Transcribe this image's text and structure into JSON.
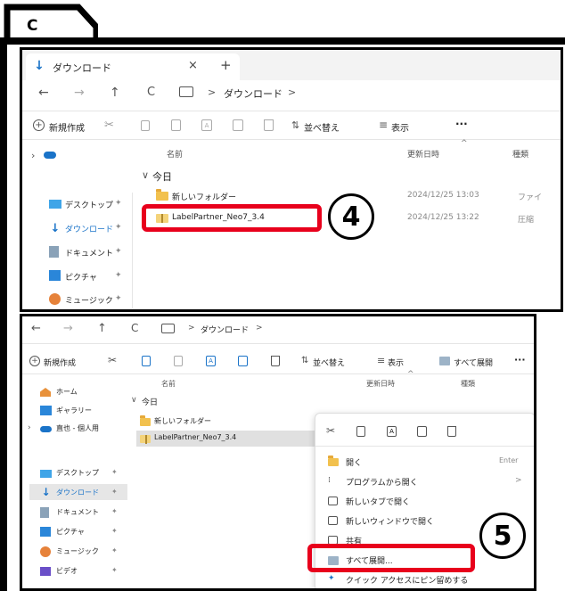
{
  "tag": {
    "letter": "C"
  },
  "panel1": {
    "tab_title": "ダウンロード",
    "tab_close": "×",
    "tab_new": "+",
    "nav_back": "←",
    "nav_forward": "→",
    "nav_up": "↑",
    "nav_refresh": "C",
    "address": "ダウンロード",
    "address_chevron": ">",
    "toolbar": {
      "new": "新規作成",
      "sort": "並べ替え",
      "view": "表示",
      "more": "···"
    },
    "columns": {
      "name": "名前",
      "date": "更新日時",
      "type": "種類"
    },
    "group": "今日",
    "sidebar": [
      {
        "label": "デスクトップ"
      },
      {
        "label": "ダウンロード"
      },
      {
        "label": "ドキュメント"
      },
      {
        "label": "ピクチャ"
      },
      {
        "label": "ミュージック"
      }
    ],
    "files": [
      {
        "name": "新しいフォルダー",
        "date": "2024/12/25 13:03",
        "type": "ファイ"
      },
      {
        "name": "LabelPartner_Neo7_3.4",
        "date": "2024/12/25 13:22",
        "type": "圧縮"
      }
    ],
    "step": "4"
  },
  "panel2": {
    "nav_back": "←",
    "nav_forward": "→",
    "nav_up": "↑",
    "nav_refresh": "C",
    "address": "ダウンロード",
    "address_chevron": ">",
    "toolbar": {
      "new": "新規作成",
      "sort": "並べ替え",
      "view": "表示",
      "extract_all": "すべて展開",
      "more": "···"
    },
    "columns": {
      "name": "名前",
      "date": "更新日時",
      "type": "種類"
    },
    "group": "今日",
    "sidebar": [
      {
        "label": "ホーム"
      },
      {
        "label": "ギャラリー"
      },
      {
        "label": "直也 - 個人用"
      },
      {
        "label": "デスクトップ"
      },
      {
        "label": "ダウンロード"
      },
      {
        "label": "ドキュメント"
      },
      {
        "label": "ピクチャ"
      },
      {
        "label": "ミュージック"
      },
      {
        "label": "ビデオ"
      }
    ],
    "files": [
      {
        "name": "新しいフォルダー"
      },
      {
        "name": "LabelPartner_Neo7_3.4"
      }
    ],
    "context_menu": {
      "items": [
        {
          "label": "開く",
          "shortcut": "Enter"
        },
        {
          "label": "プログラムから開く",
          "shortcut": ">"
        },
        {
          "label": "新しいタブで開く",
          "shortcut": ""
        },
        {
          "label": "新しいウィンドウで開く",
          "shortcut": ""
        },
        {
          "label": "共有",
          "shortcut": ""
        },
        {
          "label": "すべて展開...",
          "shortcut": ""
        },
        {
          "label": "クイック アクセスにピン留めする",
          "shortcut": ""
        }
      ]
    },
    "step": "5"
  },
  "colors": {
    "highlight_red": "#e8001c",
    "folder_yellow": "#f2c14e",
    "accent_blue": "#1a73c8"
  }
}
